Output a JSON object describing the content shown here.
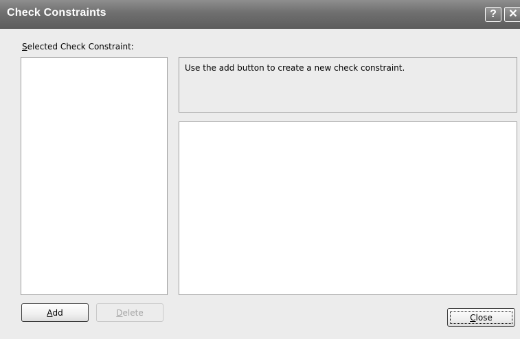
{
  "window": {
    "title": "Check Constraints",
    "help_glyph": "?",
    "close_glyph": "✕"
  },
  "left_panel": {
    "label_accel": "S",
    "label_rest": "elected Check Constraint:",
    "items": []
  },
  "right_panel": {
    "description": "Use the add button to create a new check constraint.",
    "properties": []
  },
  "buttons": {
    "add_accel": "A",
    "add_rest": "dd",
    "delete_accel": "D",
    "delete_rest": "elete",
    "close_accel": "C",
    "close_rest": "lose"
  },
  "state": {
    "delete_enabled": false
  },
  "colors": {
    "title_bar": "#6f6f6f",
    "dialog_background": "#ececec",
    "border": "#9e9e9e",
    "disabled_text": "#a6a6a6"
  },
  "icons": {
    "help": "help-icon",
    "close": "close-icon"
  }
}
